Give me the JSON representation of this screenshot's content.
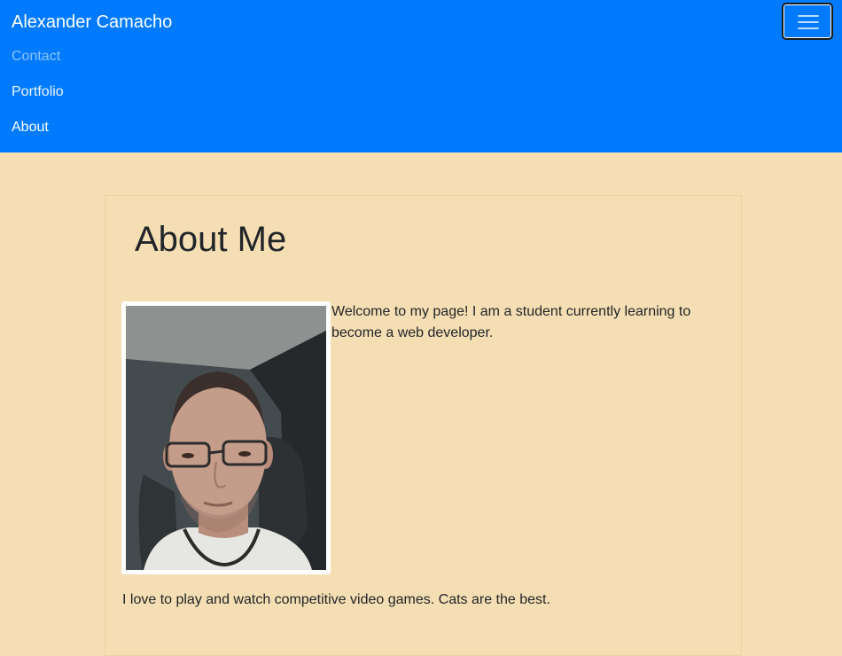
{
  "navbar": {
    "brand": "Alexander Camacho",
    "links": {
      "contact": "Contact",
      "portfolio": "Portfolio",
      "about": "About"
    },
    "toggler_icon": "hamburger-menu-icon",
    "background_color": "#007bff"
  },
  "main": {
    "title": "About Me",
    "photo": "profile-photo",
    "intro": "Welcome to my page! I am a student currently learning to become a web developer.",
    "hobbies": "I love to play and watch competitive video games. Cats are the best."
  },
  "page": {
    "background_color": "#f5deb3"
  }
}
